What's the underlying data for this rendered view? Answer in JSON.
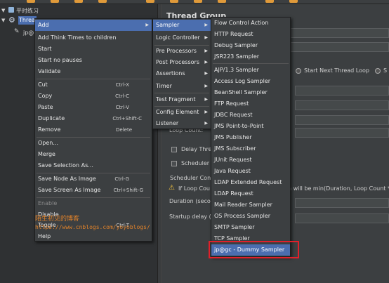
{
  "tree": {
    "root_label": "平时练习",
    "thread_group_label": "Thread Group",
    "child_label": "jp@"
  },
  "right": {
    "title": "Thread Group",
    "radio_start_next": "Start Next Thread Loop",
    "radio_stop": "S",
    "loop_count_label": "Loop Count:",
    "delay_label": "Delay Thre",
    "scheduler_label": "Scheduler",
    "scheduler_config_label": "Scheduler Con",
    "warning_text": "If Loop Cou",
    "warning_tail": "n will be min(Duration, Loop Count *",
    "duration_label": "Duration (secor",
    "startup_label": "Startup delay (s"
  },
  "context_menu": {
    "items": [
      {
        "label": "Add",
        "submenu": true,
        "selected": true
      },
      {
        "label": "Add Think Times to children"
      },
      {
        "label": "Start"
      },
      {
        "label": "Start no pauses"
      },
      {
        "label": "Validate"
      },
      {
        "label": "Cut",
        "shortcut": "Ctrl-X"
      },
      {
        "label": "Copy",
        "shortcut": "Ctrl-C"
      },
      {
        "label": "Paste",
        "shortcut": "Ctrl-V"
      },
      {
        "label": "Duplicate",
        "shortcut": "Ctrl+Shift-C"
      },
      {
        "label": "Remove",
        "shortcut": "Delete"
      },
      {
        "label": "Open..."
      },
      {
        "label": "Merge"
      },
      {
        "label": "Save Selection As..."
      },
      {
        "label": "Save Node As Image",
        "shortcut": "Ctrl-G"
      },
      {
        "label": "Save Screen As Image",
        "shortcut": "Ctrl+Shift-G"
      },
      {
        "label": "Enable",
        "disabled": true
      },
      {
        "label": "Disable"
      },
      {
        "label": "Toggle",
        "shortcut": "Ctrl-T"
      },
      {
        "label": "Help"
      }
    ]
  },
  "add_menu": {
    "items": [
      {
        "label": "Sampler",
        "selected": true
      },
      {
        "label": "Logic Controller"
      },
      {
        "label": "Pre Processors"
      },
      {
        "label": "Post Processors"
      },
      {
        "label": "Assertions"
      },
      {
        "label": "Timer"
      },
      {
        "label": "Test Fragment"
      },
      {
        "label": "Config Element"
      },
      {
        "label": "Listener"
      }
    ]
  },
  "sampler_menu": {
    "items": [
      {
        "label": "Flow Control Action"
      },
      {
        "label": "HTTP Request"
      },
      {
        "label": "Debug Sampler"
      },
      {
        "label": "JSR223 Sampler"
      },
      {
        "label": "AJP/1.3 Sampler"
      },
      {
        "label": "Access Log Sampler"
      },
      {
        "label": "BeanShell Sampler"
      },
      {
        "label": "FTP Request"
      },
      {
        "label": "JDBC Request"
      },
      {
        "label": "JMS Point-to-Point"
      },
      {
        "label": "JMS Publisher"
      },
      {
        "label": "JMS Subscriber"
      },
      {
        "label": "JUnit Request"
      },
      {
        "label": "Java Request"
      },
      {
        "label": "LDAP Extended Request"
      },
      {
        "label": "LDAP Request"
      },
      {
        "label": "Mail Reader Sampler"
      },
      {
        "label": "OS Process Sampler"
      },
      {
        "label": "SMTP Sampler"
      },
      {
        "label": "TCP Sampler"
      },
      {
        "label": "jp@gc - Dummy Sampler",
        "selected": true
      }
    ]
  },
  "watermark": {
    "line1": "陌生初见的博客",
    "line2": "https://www.cnblogs.com/yoyoblogs/"
  },
  "colors": {
    "selection": "#4b6eaf",
    "highlight_box": "#e0202a",
    "watermark": "#e0822a"
  }
}
